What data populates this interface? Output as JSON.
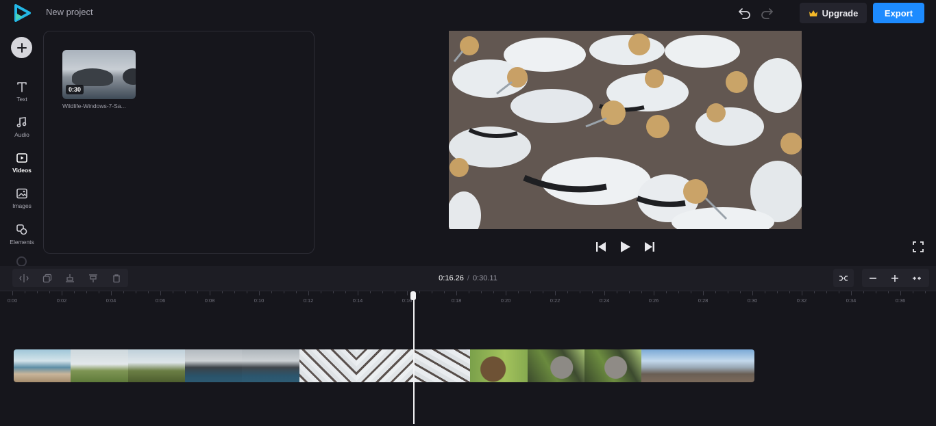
{
  "header": {
    "project_title": "New project",
    "upgrade_label": "Upgrade",
    "export_label": "Export",
    "accent_color": "#1d8bff"
  },
  "sidebar": {
    "items": [
      {
        "label": "Text",
        "icon": "text-icon"
      },
      {
        "label": "Audio",
        "icon": "music-note-icon"
      },
      {
        "label": "Videos",
        "icon": "video-icon",
        "active": true
      },
      {
        "label": "Images",
        "icon": "image-icon"
      },
      {
        "label": "Elements",
        "icon": "elements-icon"
      }
    ]
  },
  "media": {
    "items": [
      {
        "name": "Wildlife-Windows-7-Sa...",
        "duration": "0:30"
      }
    ]
  },
  "timeline": {
    "current_time": "0:16.26",
    "separator": "/",
    "total_time": "0:30.11",
    "ruler_labels": [
      "0:00",
      "0:02",
      "0:04",
      "0:06",
      "0:08",
      "0:10",
      "0:12",
      "0:14",
      "0:16",
      "0:18",
      "0:20",
      "0:22",
      "0:24",
      "0:26",
      "0:28",
      "0:30",
      "0:32",
      "0:34",
      "0:36"
    ]
  }
}
